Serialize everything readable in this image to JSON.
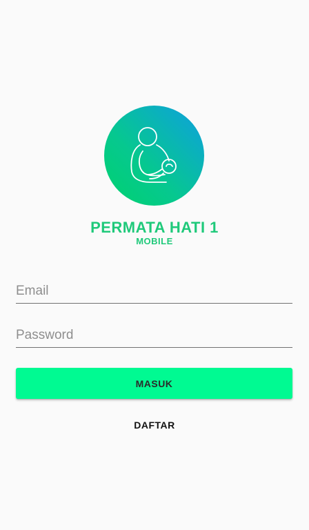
{
  "brand": {
    "title": "PERMATA HATI 1",
    "subtitle": "MOBILE",
    "logo_icon": "mother-baby-icon",
    "colors": {
      "accent": "#1fc97a",
      "gradient_start": "#00d26e",
      "gradient_end": "#0e9fe0"
    }
  },
  "form": {
    "email": {
      "value": "",
      "placeholder": "Email"
    },
    "password": {
      "value": "",
      "placeholder": "Password"
    },
    "login_label": "MASUK",
    "login_color": "#00fa92",
    "register_label": "DAFTAR"
  }
}
